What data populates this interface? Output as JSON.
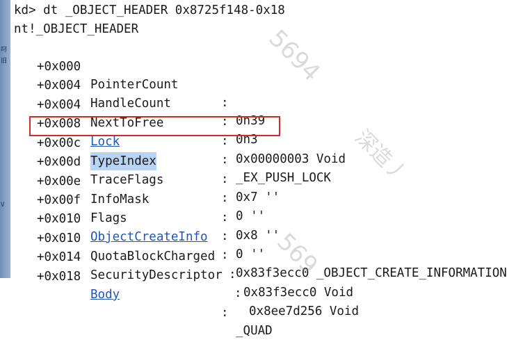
{
  "console": {
    "command": "kd> dt _OBJECT_HEADER 0x8725f148-0x18",
    "type_name": "nt!_OBJECT_HEADER",
    "fields": [
      {
        "offset": "+0x000",
        "name": "PointerCount",
        "value": "0n39"
      },
      {
        "offset": "+0x004",
        "name": "HandleCount",
        "value": "0n3"
      },
      {
        "offset": "+0x004",
        "name": "NextToFree",
        "value": "0x00000003 Void"
      },
      {
        "offset": "+0x008",
        "name": "Lock",
        "value": "_EX_PUSH_LOCK"
      },
      {
        "offset": "+0x00c",
        "name": "TypeIndex",
        "value": "0x7 ''"
      },
      {
        "offset": "+0x00d",
        "name": "TraceFlags",
        "value": "0 ''"
      },
      {
        "offset": "+0x00e",
        "name": "InfoMask",
        "value": "0x8 ''"
      },
      {
        "offset": "+0x00f",
        "name": "Flags",
        "value": "0 ''"
      },
      {
        "offset": "+0x010",
        "name": "ObjectCreateInfo",
        "value": "0x83f3ecc0 _OBJECT_CREATE_INFORMATION"
      },
      {
        "offset": "+0x010",
        "name": "QuotaBlockCharged",
        "value": "0x83f3ecc0 Void"
      },
      {
        "offset": "+0x014",
        "name": "SecurityDescriptor",
        "value": "0x8ee7d256 Void"
      },
      {
        "offset": "+0x018",
        "name": "Body",
        "value": "_QUAD"
      }
    ]
  },
  "separator": ":",
  "watermark": {
    "mark1": "5694",
    "mark2": "深造丿",
    "mark3": "569"
  },
  "left_strip": {
    "glyph1": "叼",
    "glyph2": "旧",
    "glyph3": "V"
  },
  "colors": {
    "link": "#1f57b8",
    "highlight": "#b9d3f2",
    "box": "#d22b2b"
  }
}
